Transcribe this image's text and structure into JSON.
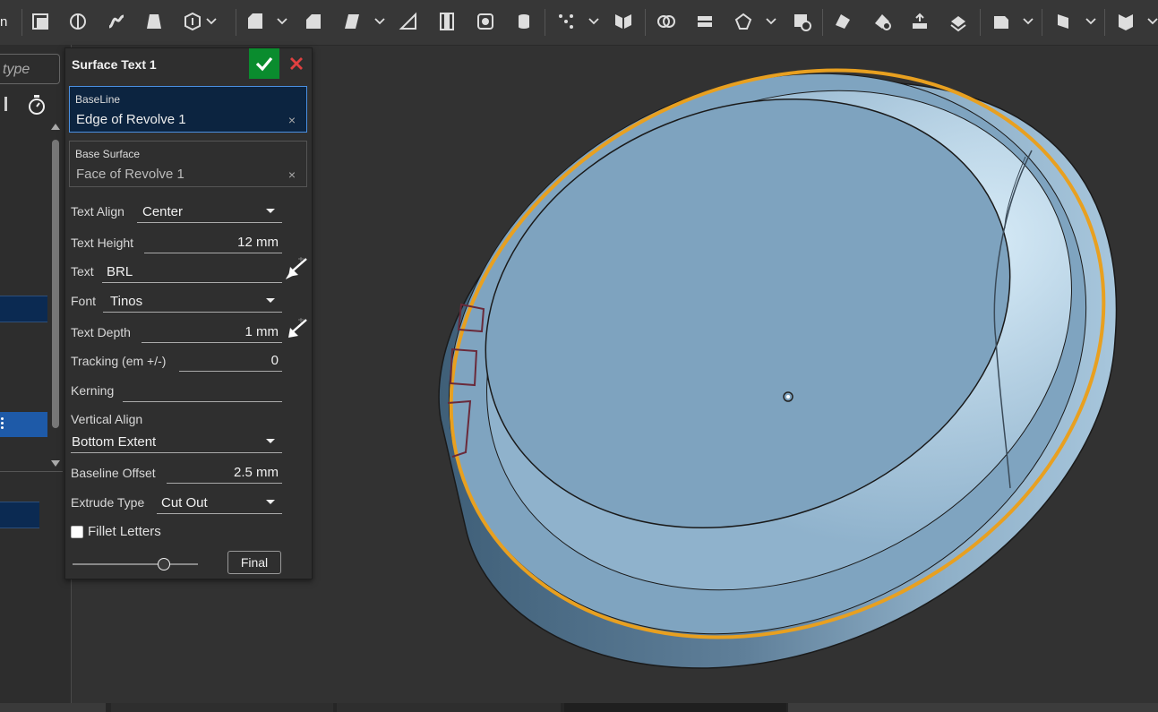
{
  "toolbar": {
    "left_partial_label": "n",
    "icons": [
      "new-sketch-icon",
      "revolve-icon",
      "sweep-icon",
      "loft-icon",
      "thicken-icon",
      "fillet-icon",
      "chamfer-icon",
      "draft-icon",
      "rib-icon",
      "shell-icon",
      "hole-icon",
      "thread-icon",
      "pattern-icon",
      "mirror-icon",
      "boolean-icon",
      "split-icon",
      "transform-icon",
      "delete-part-icon",
      "modify-face-icon",
      "delete-face-icon",
      "replace-face-icon",
      "move-face-icon",
      "plane-icon",
      "mate-connector-icon",
      "sheet-metal-icon"
    ]
  },
  "tree": {
    "search_placeholder": "type"
  },
  "dialog": {
    "title": "Surface Text 1",
    "baseline": {
      "label": "BaseLine",
      "value": "Edge of Revolve 1",
      "clear": "×"
    },
    "base_surface": {
      "label": "Base Surface",
      "value": "Face of Revolve 1",
      "clear": "×"
    },
    "text_align": {
      "label": "Text Align",
      "value": "Center"
    },
    "text_height": {
      "label": "Text Height",
      "value": "12 mm"
    },
    "text": {
      "label": "Text",
      "value": "BRL"
    },
    "font": {
      "label": "Font",
      "value": "Tinos"
    },
    "text_depth": {
      "label": "Text Depth",
      "value": "1 mm"
    },
    "tracking": {
      "label": "Tracking (em +/-)",
      "value": "0"
    },
    "kerning": {
      "label": "Kerning",
      "value": ""
    },
    "vertical_align": {
      "label": "Vertical Align",
      "value": "Bottom Extent"
    },
    "baseline_offset": {
      "label": "Baseline Offset",
      "value": "2.5 mm"
    },
    "extrude_type": {
      "label": "Extrude Type",
      "value": "Cut Out"
    },
    "fillet_letters": {
      "label": "Fillet Letters",
      "checked": false
    },
    "slider_level": 0.72,
    "final_button": "Final"
  },
  "colors": {
    "accent_ok": "#0a8c2e",
    "cancel": "#e04040",
    "selection_edge": "#e8a020",
    "part_fill": "#8fb4d0"
  }
}
